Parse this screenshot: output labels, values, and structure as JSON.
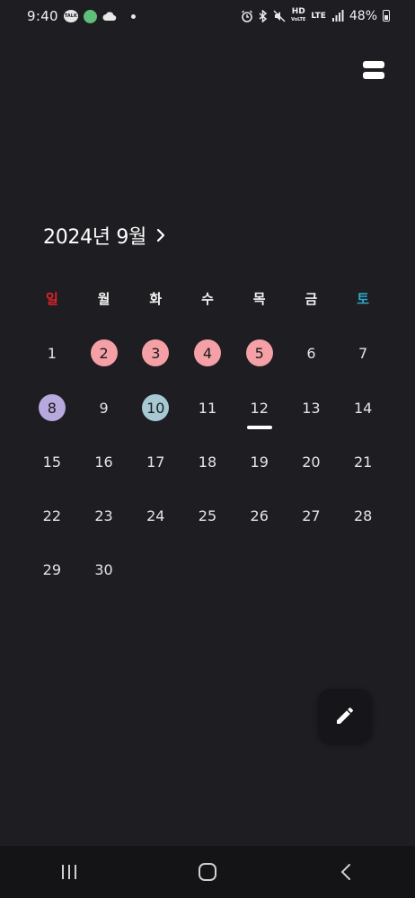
{
  "status_bar": {
    "time": "9:40",
    "talk_label": "TALK",
    "hd_label": "HD",
    "voice_label": "VoLTE",
    "lte_label": "LTE",
    "battery": "48%"
  },
  "calendar": {
    "month_title": "2024년 9월",
    "weekdays": [
      "일",
      "월",
      "화",
      "수",
      "목",
      "금",
      "토"
    ],
    "weeks": [
      [
        "1",
        "2",
        "3",
        "4",
        "5",
        "6",
        "7"
      ],
      [
        "8",
        "9",
        "10",
        "11",
        "12",
        "13",
        "14"
      ],
      [
        "15",
        "16",
        "17",
        "18",
        "19",
        "20",
        "21"
      ],
      [
        "22",
        "23",
        "24",
        "25",
        "26",
        "27",
        "28"
      ],
      [
        "29",
        "30",
        "",
        "",
        "",
        "",
        ""
      ]
    ],
    "today": "12",
    "marked_days": [
      {
        "day": "2",
        "color": "#f4a0a6"
      },
      {
        "day": "3",
        "color": "#f4a0a6"
      },
      {
        "day": "4",
        "color": "#f4a0a6"
      },
      {
        "day": "5",
        "color": "#f4a0a6"
      },
      {
        "day": "8",
        "color": "#b7a9dd"
      },
      {
        "day": "10",
        "color": "#a7c9d4"
      }
    ]
  },
  "colors": {
    "background": "#1e1d22",
    "sunday": "#e0232b",
    "saturday": "#2aa9c9"
  },
  "icons": {
    "menu": "menu-icon",
    "chevron": "chevron-right-icon",
    "fab": "pencil-icon",
    "nav_recent": "recent-apps-icon",
    "nav_home": "home-icon",
    "nav_back": "back-icon"
  }
}
